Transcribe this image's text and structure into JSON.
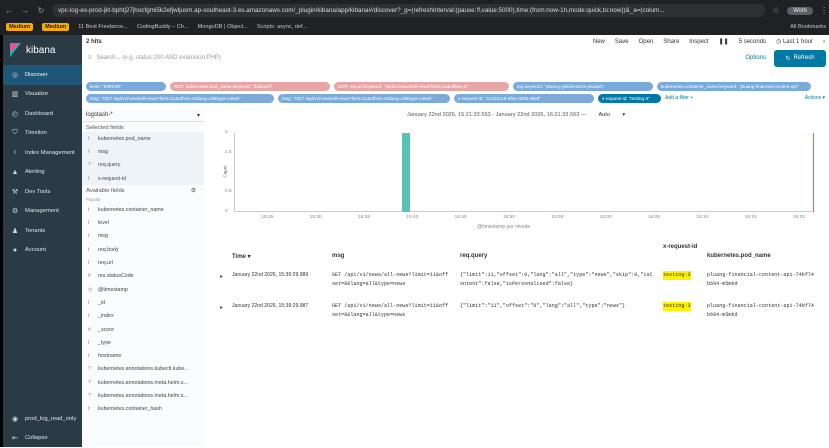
{
  "browser": {
    "url": "vpc-log-es-prod-jkt-bphtj27jhocfgmi5k2efjwljuxm.ap-southeast-3.es.amazonaws.com/_plugin/kibana/app/kibana#/discover?_g=(refreshInterval:(pause:!f,value:5000),time:(from:now-1h,mode:quick,to:now))&_a=(colum...",
    "profile": "Work",
    "bookmarks": [
      "Medium",
      "Medium",
      "11 Best Freelance...",
      "CodingBuddy – Ch...",
      "MongoDB | Object...",
      "Scripts: async, def..."
    ],
    "all_bookmarks": "All Bookmarks"
  },
  "sidebar": {
    "brand": "kibana",
    "items": [
      {
        "label": "Discover",
        "icon": "compass-icon"
      },
      {
        "label": "Visualize",
        "icon": "chart-icon"
      },
      {
        "label": "Dashboard",
        "icon": "dashboard-icon"
      },
      {
        "label": "Timelion",
        "icon": "shield-icon"
      },
      {
        "label": "Index Management",
        "icon": "index-icon"
      },
      {
        "label": "Alerting",
        "icon": "bell-icon"
      },
      {
        "label": "Dev Tools",
        "icon": "wrench-icon"
      },
      {
        "label": "Management",
        "icon": "gear-icon"
      },
      {
        "label": "Tenants",
        "icon": "users-icon"
      },
      {
        "label": "Account",
        "icon": "user-icon"
      }
    ],
    "user": "prod_log_read_only",
    "collapse": "Collapse"
  },
  "topbar": {
    "hits": "2 hits",
    "links": [
      "New",
      "Save",
      "Open",
      "Share",
      "Inspect"
    ],
    "interval": "5 seconds",
    "time": "Last 1 hour"
  },
  "search": {
    "placeholder": "Search... (e.g. status:200 AND extension:PHP)",
    "options": "Options",
    "refresh": "Refresh"
  },
  "filters": [
    "level: \"ERROR\"",
    "NOT: kubernetes.pod_name.keyword: \"finboard\"",
    "NOT: req.url.keyword: \"/api/v1/news/all-news?limit=11&offset=0\"",
    "tag.keyword: \"pluang-global-stock-product\"",
    "kubernetes.container_name.keyword: \"pluang-financial-content-api\"",
    "msg: \"GET /api/v1/news/all-news?limit=11&offset=0&lang=all&type=news\"",
    "msg: \"GET /api/v1/news/all-news?limit=11&offset=0&lang=all&type=news\"",
    "x-request-id: \"31323cc9-8f4e-40d5-98af\"",
    "x-request-id: \"testing-3\""
  ],
  "add_filter": "Add a filter +",
  "actions": "Actions ▾",
  "index": {
    "pattern": "logstash-*",
    "selected_title": "Selected fields",
    "selected": [
      {
        "type": "t",
        "name": "kubernetes.pod_name"
      },
      {
        "type": "t",
        "name": "msg"
      },
      {
        "type": "?",
        "name": "req.query"
      },
      {
        "type": "t",
        "name": "x-request-id"
      }
    ],
    "available_title": "Available fields",
    "popular": "Popular",
    "available": [
      {
        "type": "t",
        "name": "kubernetes.container_name"
      },
      {
        "type": "t",
        "name": "level"
      },
      {
        "type": "t",
        "name": "msg"
      },
      {
        "type": "t",
        "name": "req.body"
      },
      {
        "type": "t",
        "name": "req.url"
      },
      {
        "type": "#",
        "name": "res.statusCode"
      },
      {
        "type": "◷",
        "name": "@timestamp"
      },
      {
        "type": "t",
        "name": "_id"
      },
      {
        "type": "t",
        "name": "_index"
      },
      {
        "type": "#",
        "name": "_score"
      },
      {
        "type": "t",
        "name": "_type"
      },
      {
        "type": "t",
        "name": "hostname"
      },
      {
        "type": "?",
        "name": "kubernetes.annotations.kubectl.kube..."
      },
      {
        "type": "?",
        "name": "kubernetes.annotations.meta.helm.s..."
      },
      {
        "type": "?",
        "name": "kubernetes.annotations.meta.helm.s..."
      },
      {
        "type": "t",
        "name": "kubernetes.container_hash"
      }
    ]
  },
  "histogram": {
    "range": "January 22nd 2026, 15:21:33.563 - January 22nd 2026, 16:21:33.563 —",
    "interval": "Auto",
    "ylabel": "Count",
    "xlabel": "@timestamp per minute"
  },
  "chart_data": {
    "type": "bar",
    "x": [
      "15:25",
      "15:30",
      "15:35",
      "15:40",
      "15:45",
      "15:50",
      "15:55",
      "16:00",
      "16:05",
      "16:10",
      "16:15",
      "16:20"
    ],
    "bars": [
      {
        "x": "15:39",
        "value": 2
      }
    ],
    "yticks": [
      0,
      0.5,
      1,
      1.5,
      2
    ],
    "ylim": [
      0,
      2
    ],
    "xlabel": "@timestamp per minute",
    "ylabel": "Count"
  },
  "table": {
    "columns": [
      "Time ▾",
      "msg",
      "req.query",
      "x-request-id",
      "kubernetes.pod_name"
    ],
    "rows": [
      {
        "time": "January 22nd 2026, 15:39:29.989",
        "msg1": "GET /api/v1/news/all-news?limit=11&off",
        "msg2": "set=0&lang=all&type=news",
        "q1": "{\"limit\":11,\"offset\":0,\"lang\":\"all\",\"type\":\"news\",\"skip\":0,\"isC",
        "q2": "ontent\":false,\"isPersonalised\":false}",
        "rid": "testing-3",
        "pod1": "pluang-financial-content-api-74bf74",
        "pod2": "b694-m5mkd"
      },
      {
        "time": "January 22nd 2026, 15:39:29.987",
        "msg1": "GET /api/v1/news/all-news?limit=11&off",
        "msg2": "set=0&lang=all&type=news",
        "q1": "{\"limit\":\"11\",\"offset\":\"0\",\"lang\":\"all\",\"type\":\"news\"}",
        "q2": "",
        "rid": "testing-3",
        "pod1": "pluang-financial-content-api-74bf74",
        "pod2": "b694-m5mkd"
      }
    ]
  }
}
